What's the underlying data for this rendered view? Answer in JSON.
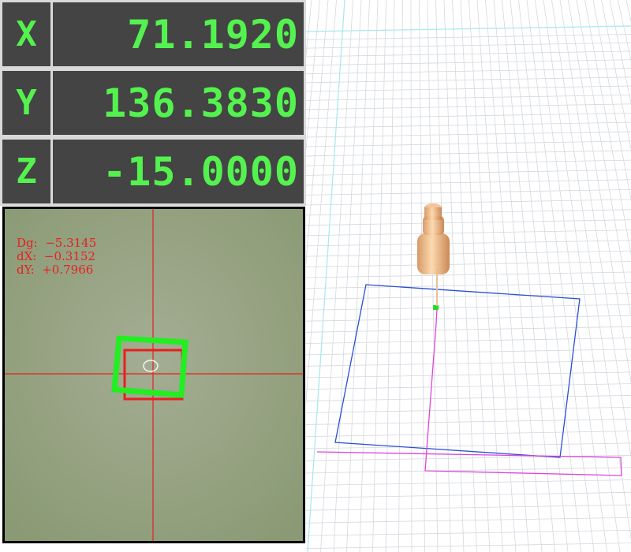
{
  "dro": {
    "x": {
      "axis": "X",
      "value": "71.1920"
    },
    "y": {
      "axis": "Y",
      "value": "136.3830"
    },
    "z": {
      "axis": "Z",
      "value": "-15.0000"
    }
  },
  "camera": {
    "dg": "Dg:  −5.3145",
    "dx": "dX:  −0.3152",
    "dy": "dY:  +0.7966"
  },
  "colors": {
    "dro_text": "#54f24f",
    "dro_background": "#444444",
    "crosshair": "#e81f1f",
    "fiducial_box": "#22ee22",
    "workpiece_outline": "#2a4fd6",
    "toolpath": "#dd44dd",
    "grid_line": "#d4d8de",
    "axis_line": "#a8e8f0",
    "tool_body": "#f0b07a"
  }
}
